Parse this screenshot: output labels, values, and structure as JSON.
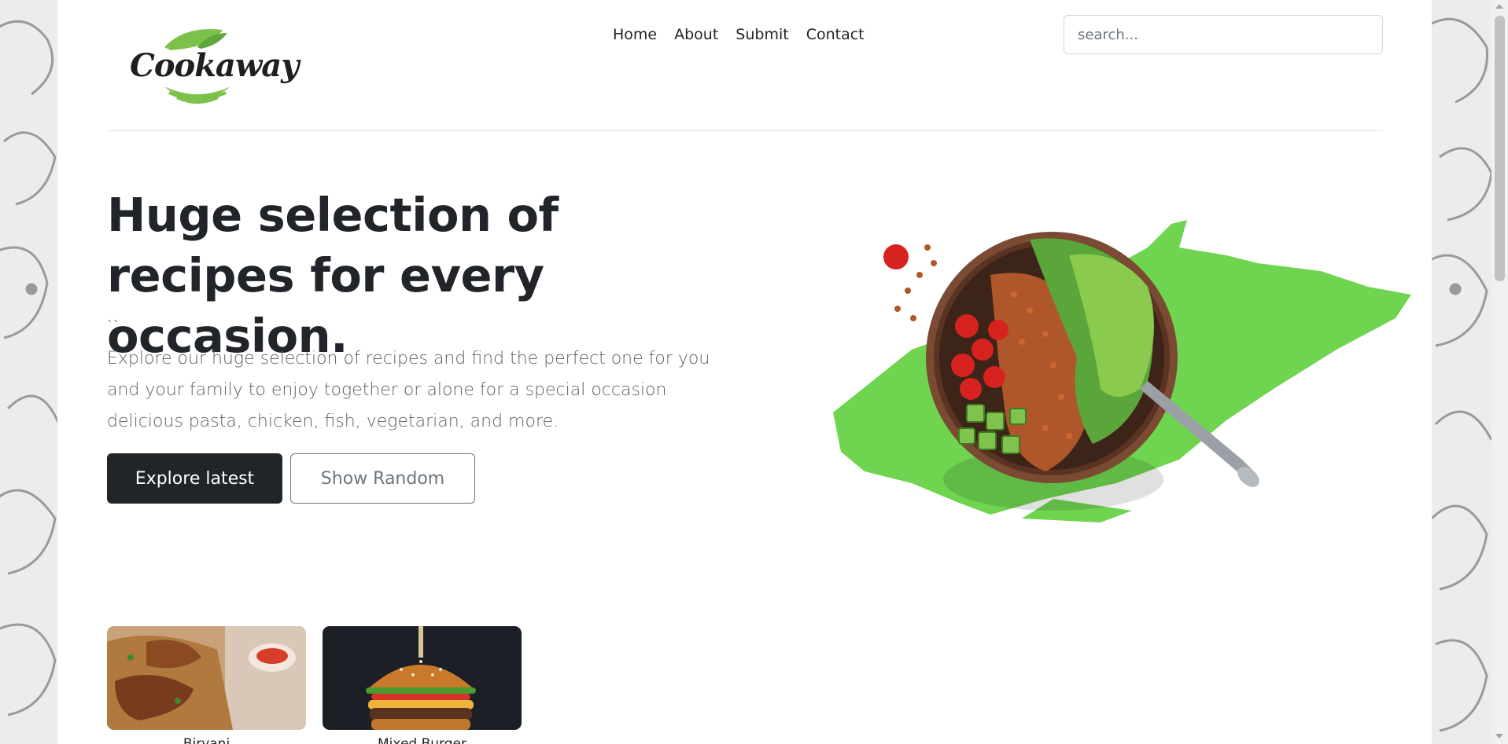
{
  "brand": {
    "name": "Cookaway",
    "leaf_color": "#7cc24a"
  },
  "nav": {
    "items": [
      {
        "label": "Home"
      },
      {
        "label": "About"
      },
      {
        "label": "Submit"
      },
      {
        "label": "Contact"
      }
    ]
  },
  "search": {
    "placeholder": "search...",
    "value": ""
  },
  "hero": {
    "title": "Huge selection of recipes for every occasion.",
    "stray_mark": "``",
    "lead": "Explore our huge selection of recipes and find the perfect one for you and your family to enjoy together or alone for a special occasion delicious pasta, chicken, fish, vegetarian, and more.",
    "primary_button": "Explore latest",
    "secondary_button": "Show Random",
    "image_icon": "salad-bowl-image"
  },
  "cards": [
    {
      "label": "Biryani",
      "image_icon": "biryani-image"
    },
    {
      "label": "Mixed Burger",
      "image_icon": "burger-image"
    }
  ],
  "colors": {
    "accent_green": "#6fd44f",
    "dark_button": "#212529",
    "muted_text": "#6c757d"
  }
}
